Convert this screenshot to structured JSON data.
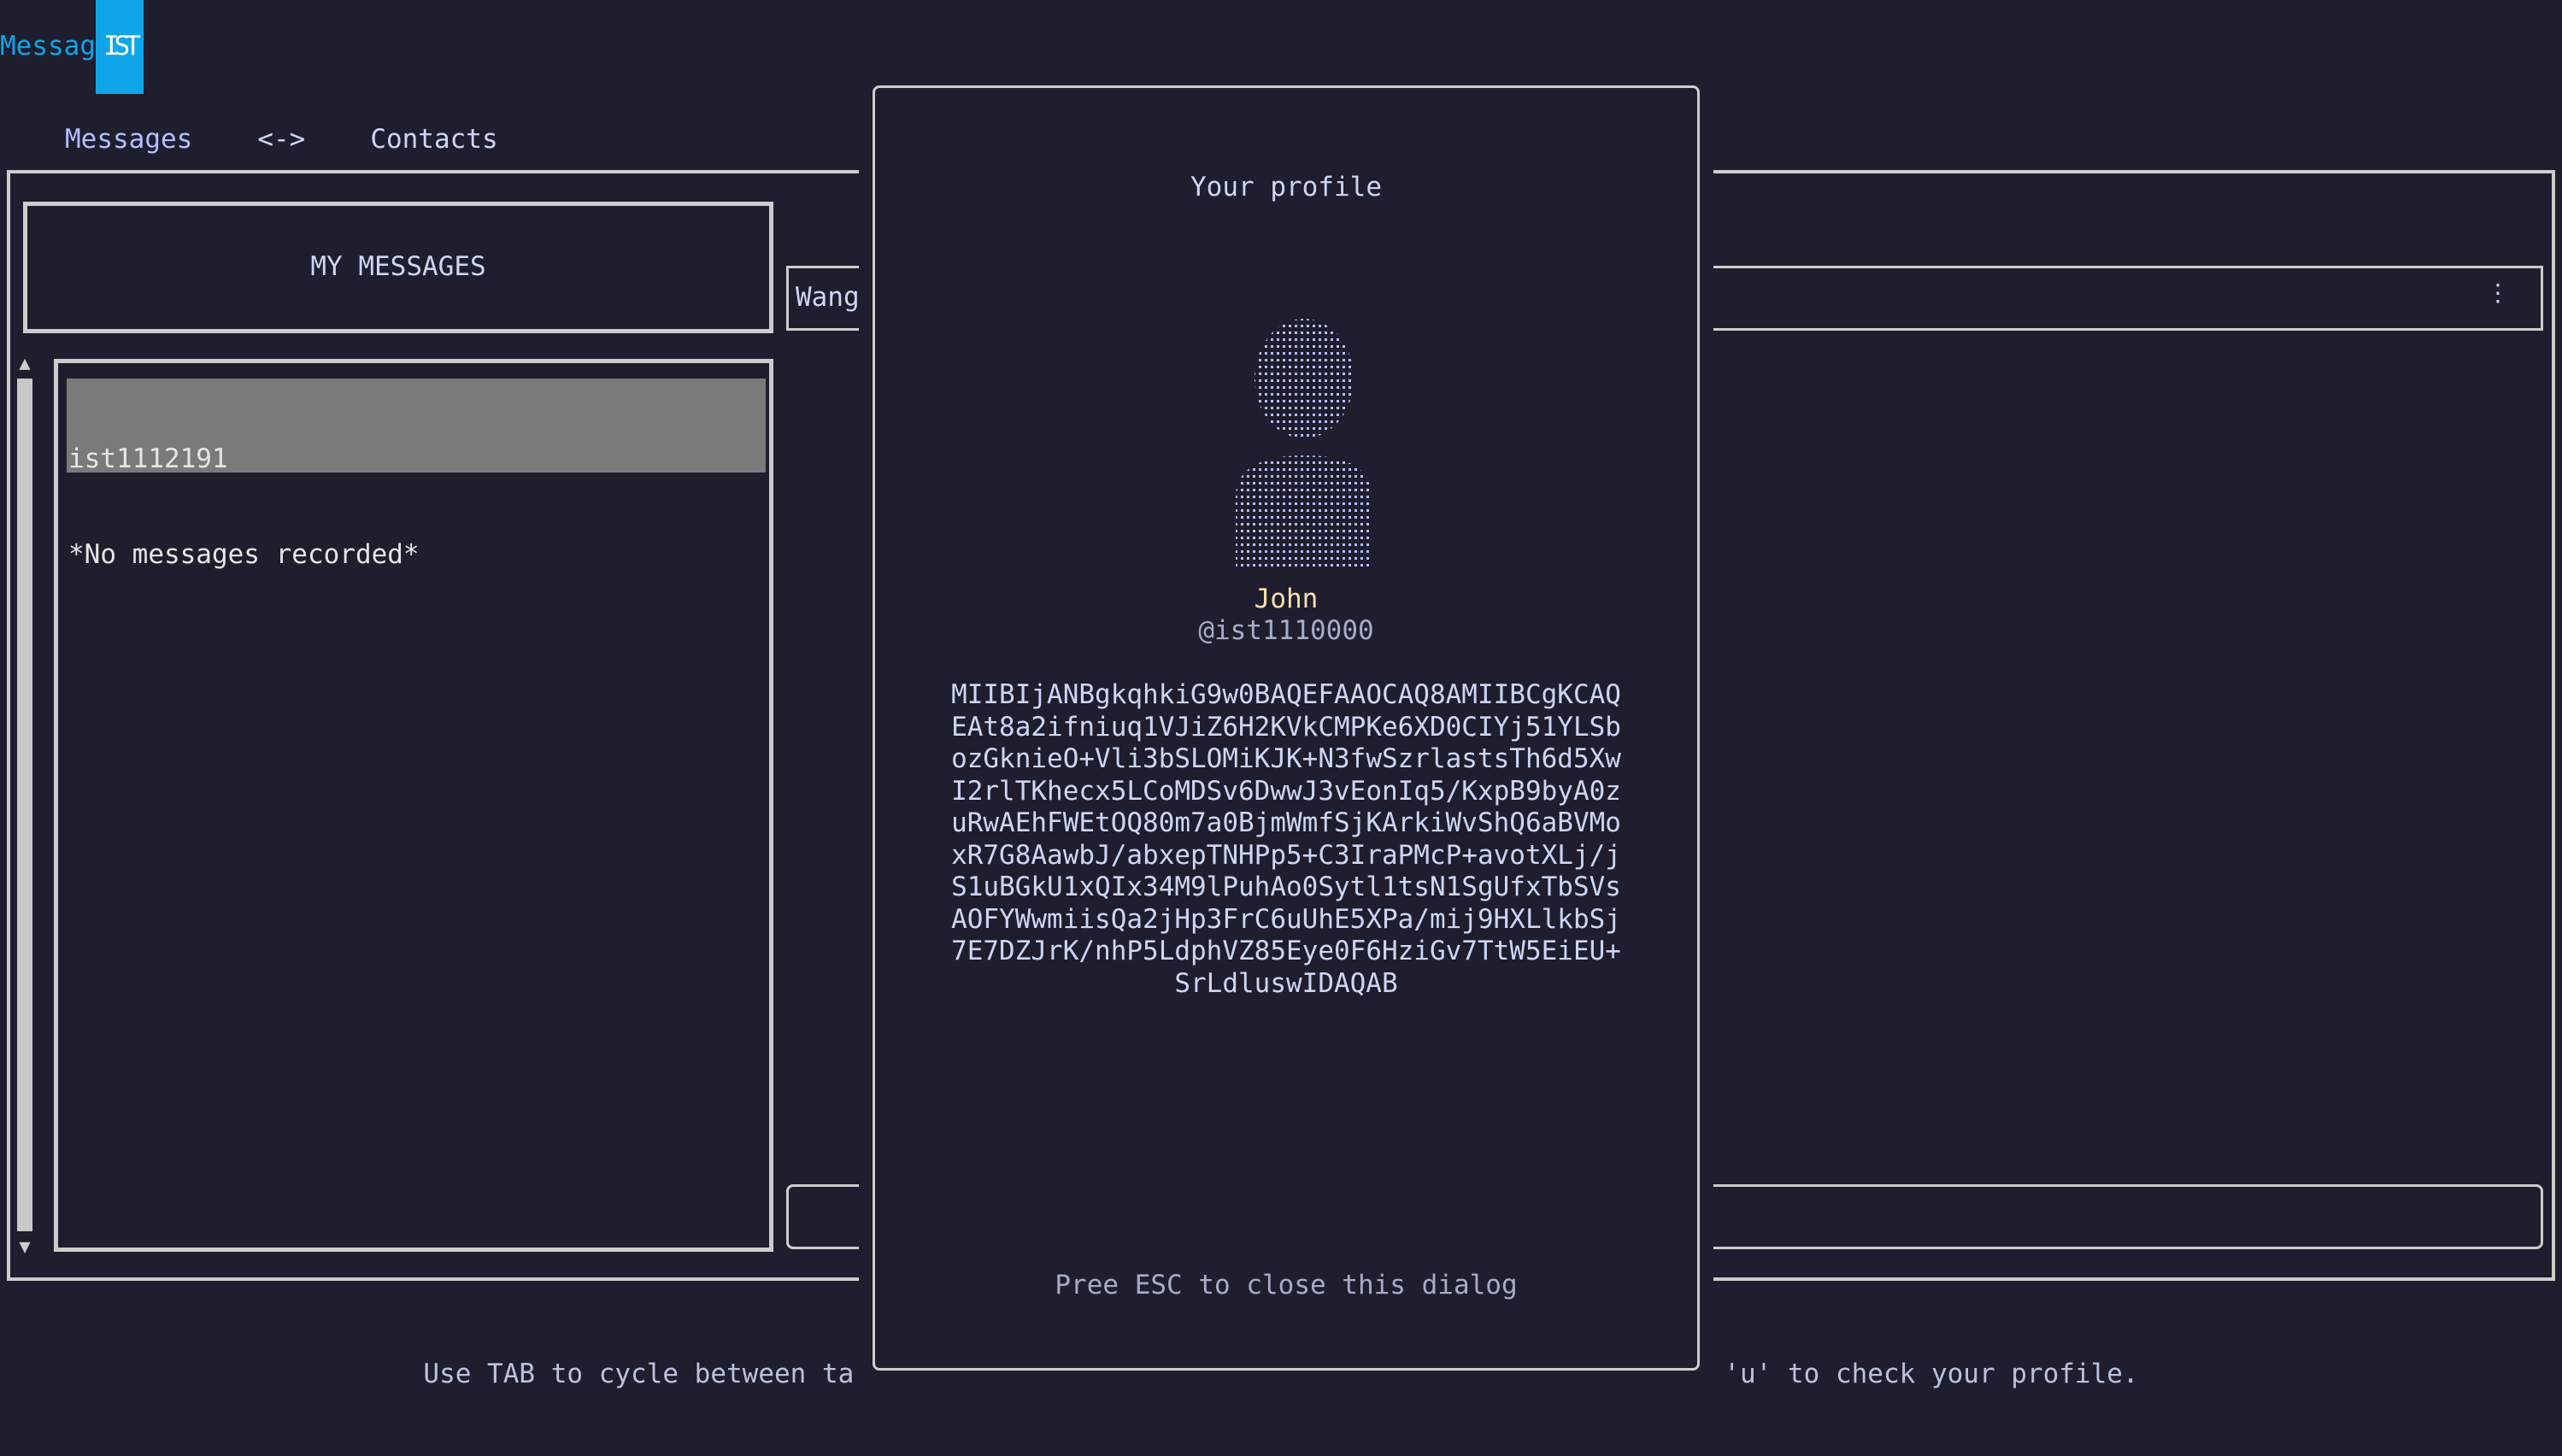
{
  "app": {
    "title_prefix": "Messag",
    "title_badge": "IST",
    "brand_color": "#0ea5e9"
  },
  "tabs": [
    {
      "label": "Messages",
      "active": true
    },
    {
      "label": "<->"
    },
    {
      "label": "Contacts"
    }
  ],
  "messages_panel": {
    "header": "MY MESSAGES",
    "items": [
      {
        "user": "ist1112191",
        "preview": "*No messages recorded*",
        "selected": true
      }
    ]
  },
  "chat": {
    "contact_name": "Wang",
    "menu_icon": "kebab-menu-icon",
    "input_placeholder": ""
  },
  "footer": {
    "left_text": "Use TAB to cycle between ta",
    "right_text": "'u' to check your profile."
  },
  "profile_dialog": {
    "title": "Your profile",
    "avatar_icon": "person-avatar-icon",
    "name": "John",
    "handle": "@ist1110000",
    "public_key_lines": [
      "MIIBIjANBgkqhkiG9w0BAQEFAAOCAQ8AMIIBCgKCAQ",
      "EAt8a2ifniuq1VJiZ6H2KVkCMPKe6XD0CIYj51YLSb",
      "ozGknieO+Vli3bSLOMiKJK+N3fwSzrlastsTh6d5Xw",
      "I2rlTKhecx5LCoMDSv6DwwJ3vEonIq5/KxpB9byA0z",
      "uRwAEhFWEtOQ80m7a0BjmWmfSjKArkiWvShQ6aBVMo",
      "xR7G8AawbJ/abxepTNHPp5+C3IraPMcP+avotXLj/j",
      "S1uBGkU1xQIx34M9lPuhAo0Sytl1tsN1SgUfxTbSVs",
      "AOFYWwmiisQa2jHp3FrC6uUhE5XPa/mij9HXLlkbSj",
      "7E7DZJrK/nhP5LdphVZ85Eye0F6HziGv7TtW5EiEU+",
      "SrLdluswIDAQAB"
    ],
    "close_hint": "Pree ESC to close this dialog"
  }
}
